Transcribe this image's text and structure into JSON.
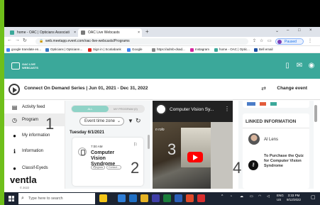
{
  "browser": {
    "tabs": [
      {
        "label": "home - OAC | Opticians Associati",
        "active": false
      },
      {
        "label": "OAC Live Webcasts",
        "active": true
      }
    ],
    "new_tab": "+",
    "window_controls": [
      "⌄",
      "–",
      "□",
      "×"
    ],
    "url": "web.meetapp.event.com/oac-live-webcasts/Programs",
    "profile_label": "Paused",
    "bookmarks": [
      {
        "label": "google translate en...",
        "color": "#4285f4"
      },
      {
        "label": "Opticians | Opticiann...",
        "color": "#3a78c4"
      },
      {
        "label": "Sign in | Scotiabank",
        "color": "#e2231a"
      },
      {
        "label": "Google",
        "color": "#4285f4"
      },
      {
        "label": "https://admb-dsad...",
        "color": "#888888"
      },
      {
        "label": "Instagram",
        "color": "#d6249f"
      },
      {
        "label": "home - OAC | Optic...",
        "color": "#3ba89a"
      },
      {
        "label": "Bell email",
        "color": "#1b4fa3"
      }
    ]
  },
  "app": {
    "logo_text": "OAC LIVE\nWEBCASTS",
    "series_title": "Connect On Demand Series | Jun 01, 2021 - Dec 31, 2022",
    "change_event": "Change event",
    "accent_color": "#3ba89a"
  },
  "sidebar": {
    "items": [
      {
        "label": "Activity feed",
        "icon": "feed-icon"
      },
      {
        "label": "Program",
        "icon": "clock-icon",
        "active": true
      },
      {
        "label": "My information",
        "icon": "person-icon"
      },
      {
        "label": "Information",
        "icon": "info-icon"
      },
      {
        "label": "Classif-Eyeds",
        "icon": "pin-icon"
      }
    ],
    "brand": "ventla",
    "brand_sub": "© 2022"
  },
  "program": {
    "toggle_all": "ALL",
    "toggle_mine": "MY PROGRAM (0)",
    "timezone_placeholder": "Event time zone",
    "day_label": "Tuesday 6/1/2021",
    "session": {
      "time": "7:00 AM",
      "title": "Computer Vision Syndrome",
      "tags": [
        "Eyeglass",
        "Contact..."
      ]
    }
  },
  "video": {
    "title": "Computer Vision Sy...",
    "caption": "n rolo"
  },
  "linked": {
    "header": "LINKED INFORMATION",
    "person": "Al Lens",
    "quiz": "To Purchase the Quiz for Computer Vision Syndrome"
  },
  "annotations": [
    "1",
    "2",
    "3",
    "4"
  ],
  "taskbar": {
    "search_placeholder": "Type here to search",
    "lang": "ENG\nUS",
    "time": "3:33 PM",
    "date": "9/12/2022"
  }
}
